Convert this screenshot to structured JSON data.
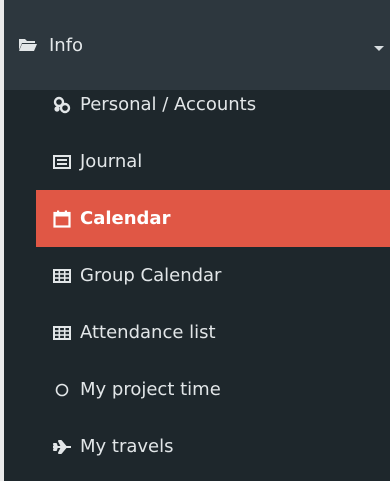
{
  "menu": {
    "group": {
      "label": "Info",
      "icon": "folder-open-icon"
    },
    "items": [
      {
        "label": "Personal / Accounts",
        "icon": "link-icon",
        "active": false
      },
      {
        "label": "Journal",
        "icon": "journal-icon",
        "active": false
      },
      {
        "label": "Calendar",
        "icon": "calendar-icon",
        "active": true
      },
      {
        "label": "Group Calendar",
        "icon": "grid-icon",
        "active": false
      },
      {
        "label": "Attendance list",
        "icon": "grid-icon",
        "active": false
      },
      {
        "label": "My project time",
        "icon": "circle-icon",
        "active": false
      },
      {
        "label": "My travels",
        "icon": "plane-icon",
        "active": false
      }
    ]
  },
  "colors": {
    "sidebar_bg": "#1e272c",
    "header_bg": "#2d373e",
    "active_bg": "#e05745",
    "text": "#e2e6e8"
  }
}
